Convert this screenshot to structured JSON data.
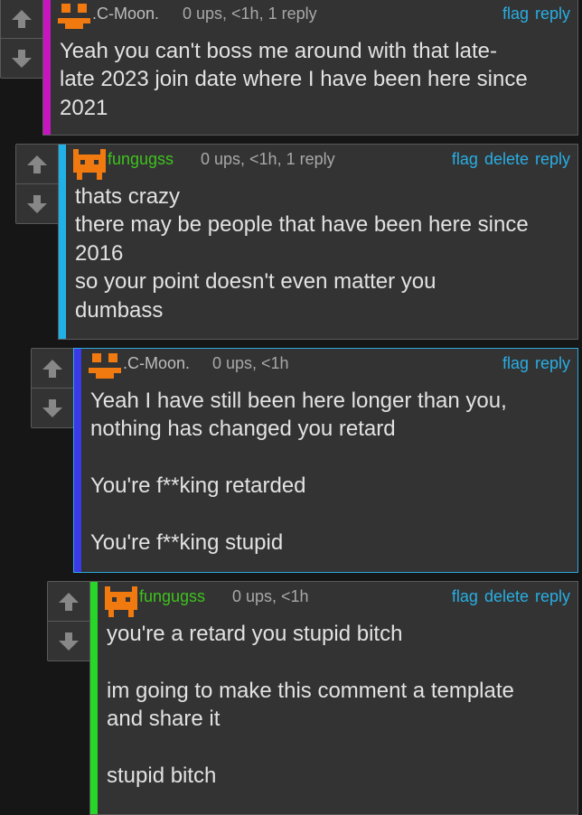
{
  "colors": {
    "background": "#161616",
    "card": "#333333",
    "link": "#29aee3",
    "stats_text": "#a8a8a8",
    "avatar_orange": "#f07a10"
  },
  "comments": [
    {
      "username": ".C-Moon.",
      "username_color": "#bdbdbd",
      "depth_bar_color": "#c716c0",
      "stats": "0 ups, <1h, 1 reply",
      "actions": [
        "flag",
        "reply"
      ],
      "text": "Yeah you can't boss me around with that late-\nlate 2023 join date where I have been here since\n2021",
      "avatar": "orange-robot-avatar"
    },
    {
      "username": "fungugss",
      "username_color": "#3ec21e",
      "depth_bar_color": "#20b2e6",
      "stats": "0 ups, <1h, 1 reply",
      "actions": [
        "flag",
        "delete",
        "reply"
      ],
      "text": "thats crazy\nthere may be people that have been here since\n2016\nso your point doesn't even matter you\ndumbass",
      "avatar": "orange-cat-avatar"
    },
    {
      "username": ".C-Moon.",
      "username_color": "#bdbdbd",
      "depth_bar_color": "#3a3ae6",
      "stats": "0 ups, <1h",
      "actions": [
        "flag",
        "reply"
      ],
      "text": "Yeah I have still been here longer than you,\nnothing has changed you retard\n\nYou're f**king retarded\n\nYou're f**king stupid",
      "avatar": "orange-robot-avatar"
    },
    {
      "username": "fungugss",
      "username_color": "#3ec21e",
      "depth_bar_color": "#27d627",
      "stats": "0 ups, <1h",
      "actions": [
        "flag",
        "delete",
        "reply"
      ],
      "text": "you're a retard you stupid bitch\n\nim going to make this comment a template\nand share it\n\nstupid bitch",
      "avatar": "orange-cat-avatar"
    }
  ]
}
